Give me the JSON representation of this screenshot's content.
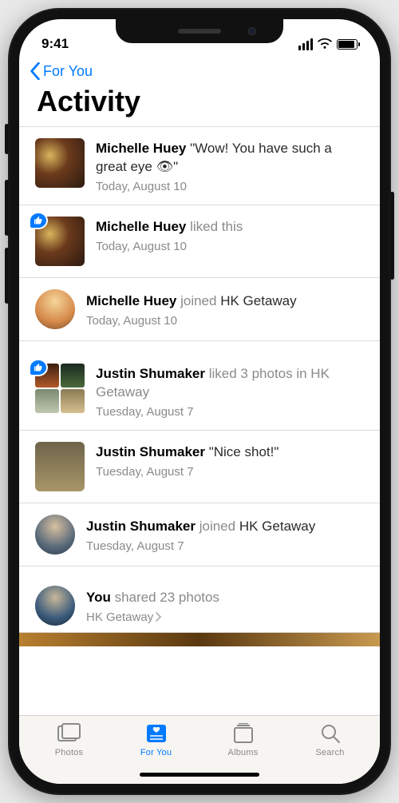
{
  "status": {
    "time": "9:41"
  },
  "nav": {
    "back_label": "For You"
  },
  "page": {
    "title": "Activity"
  },
  "activity": [
    {
      "name": "Michelle Huey",
      "text": " \"Wow! You have such a great eye 👁\"",
      "date": "Today, August 10"
    },
    {
      "name": "Michelle Huey",
      "text": " liked this",
      "date": "Today, August 10"
    },
    {
      "name": "Michelle Huey",
      "verb": " joined ",
      "album": "HK Getaway",
      "date": "Today, August 10"
    },
    {
      "name": "Justin Shumaker",
      "text": " liked 3 photos in HK Getaway",
      "date": "Tuesday, August 7"
    },
    {
      "name": "Justin Shumaker",
      "text": " \"Nice shot!\"",
      "date": "Tuesday, August 7"
    },
    {
      "name": "Justin Shumaker",
      "verb": " joined ",
      "album": "HK Getaway",
      "date": "Tuesday, August 7"
    },
    {
      "name": "You",
      "text": " shared 23 photos",
      "date": "HK Getaway"
    }
  ],
  "tabs": {
    "photos": "Photos",
    "for_you": "For You",
    "albums": "Albums",
    "search": "Search"
  }
}
